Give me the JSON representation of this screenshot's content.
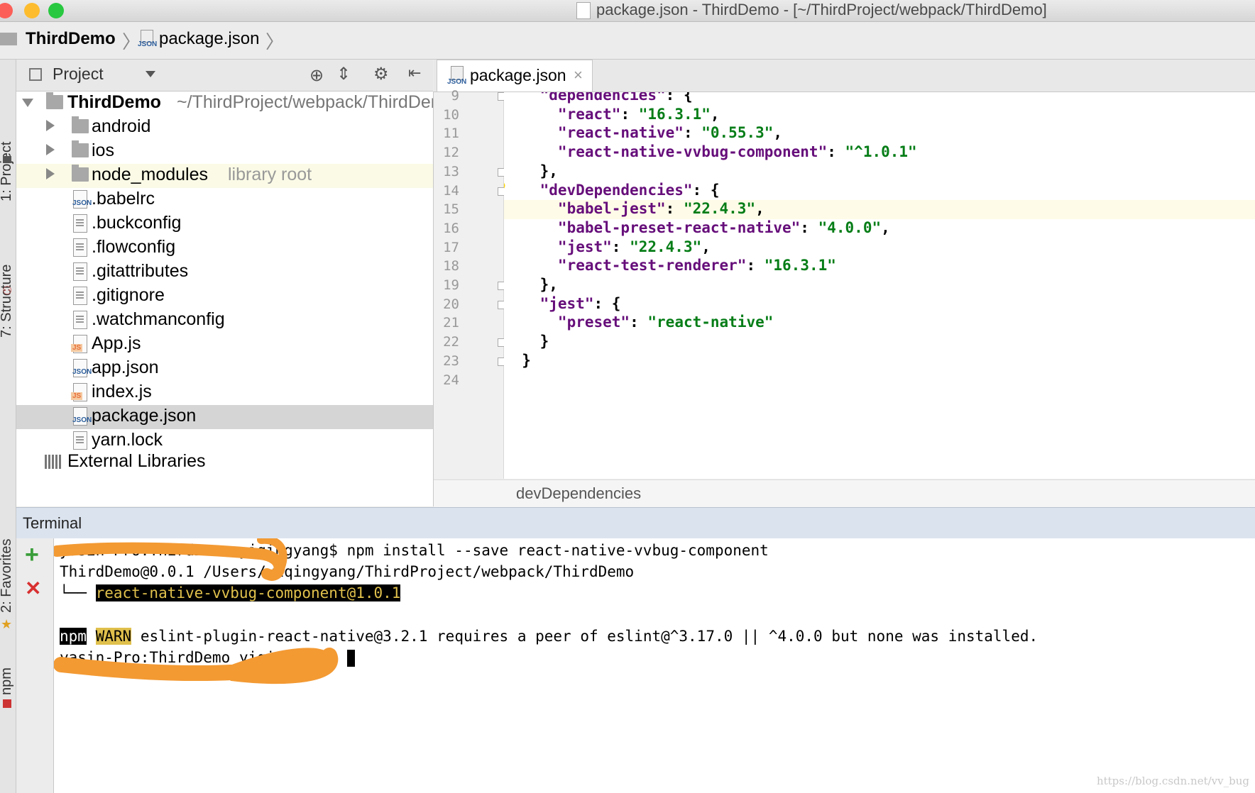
{
  "window": {
    "title": "package.json - ThirdDemo - [~/ThirdProject/webpack/ThirdDemo]",
    "traffic": {
      "close": "#fc5f57",
      "minimize": "#fdbc2e",
      "zoom": "#28c840"
    }
  },
  "nav": {
    "project": "ThirdDemo",
    "file": "package.json",
    "file_tag": "JSON"
  },
  "left_stripe": {
    "project_tab": "1: Project",
    "structure_tab": "7: Structure",
    "favorites_tab": "2: Favorites",
    "npm_tab": "npm"
  },
  "project_panel": {
    "header_label": "Project",
    "root_name": "ThirdDemo",
    "root_path": "~/ThirdProject/webpack/ThirdDemo",
    "items": [
      {
        "label": "android",
        "kind": "folder"
      },
      {
        "label": "ios",
        "kind": "folder"
      },
      {
        "label": "node_modules",
        "kind": "folder",
        "hint": "library root"
      },
      {
        "label": ".babelrc",
        "kind": "json",
        "tag": "JSON"
      },
      {
        "label": ".buckconfig",
        "kind": "text"
      },
      {
        "label": ".flowconfig",
        "kind": "text"
      },
      {
        "label": ".gitattributes",
        "kind": "text"
      },
      {
        "label": ".gitignore",
        "kind": "text"
      },
      {
        "label": ".watchmanconfig",
        "kind": "text"
      },
      {
        "label": "App.js",
        "kind": "js",
        "tag": "JS"
      },
      {
        "label": "app.json",
        "kind": "json",
        "tag": "JSON"
      },
      {
        "label": "index.js",
        "kind": "js",
        "tag": "JS"
      },
      {
        "label": "package.json",
        "kind": "json",
        "tag": "JSON",
        "selected": true
      },
      {
        "label": "yarn.lock",
        "kind": "text"
      }
    ],
    "external": "External Libraries"
  },
  "editor": {
    "tab_label": "package.json",
    "tab_tag": "JSON",
    "close_glyph": "×",
    "breadcrumb": "devDependencies",
    "current_line": 15,
    "lines": [
      {
        "n": "9",
        "text": "  \"dependencies\": {"
      },
      {
        "n": "10",
        "text": "    \"react\": \"16.3.1\","
      },
      {
        "n": "11",
        "text": "    \"react-native\": \"0.55.3\","
      },
      {
        "n": "12",
        "text": "    \"react-native-vvbug-component\": \"^1.0.1\""
      },
      {
        "n": "13",
        "text": "  },"
      },
      {
        "n": "14",
        "text": "  \"devDependencies\": {"
      },
      {
        "n": "15",
        "text": "    \"babel-jest\": \"22.4.3\","
      },
      {
        "n": "16",
        "text": "    \"babel-preset-react-native\": \"4.0.0\","
      },
      {
        "n": "17",
        "text": "    \"jest\": \"22.4.3\","
      },
      {
        "n": "18",
        "text": "    \"react-test-renderer\": \"16.3.1\""
      },
      {
        "n": "19",
        "text": "  },"
      },
      {
        "n": "20",
        "text": "  \"jest\": {"
      },
      {
        "n": "21",
        "text": "    \"preset\": \"react-native\""
      },
      {
        "n": "22",
        "text": "  }"
      },
      {
        "n": "23",
        "text": "}"
      },
      {
        "n": "24",
        "text": ""
      }
    ]
  },
  "terminal": {
    "title": "Terminal",
    "add_glyph": "+",
    "close_glyph": "✕",
    "line1_prompt": "yasin-Pro:ThirdDemo yiqingyang$",
    "line1_cmd": " npm install --save react-native-vvbug-component",
    "line2": "ThirdDemo@0.0.1 /Users/yiqingyang/ThirdProject/webpack/ThirdDemo",
    "line3_branch": "└── ",
    "line3_pkg": "react-native-vvbug-component@1.0.1",
    "line4_npm": "npm",
    "line4_warn": "WARN",
    "line4_msg": " eslint-plugin-react-native@3.2.1 requires a peer of eslint@^3.17.0 || ^4.0.0 but none was installed.",
    "line5_prompt": "yasin-Pro:ThirdDemo yiqingyang$ "
  },
  "watermark": "https://blog.csdn.net/vv_bug",
  "colors": {
    "key": "#660e7a",
    "value": "#067d17",
    "selection": "#d5d5d5",
    "library_row": "#fafae6",
    "annotation": "#f39a33"
  }
}
